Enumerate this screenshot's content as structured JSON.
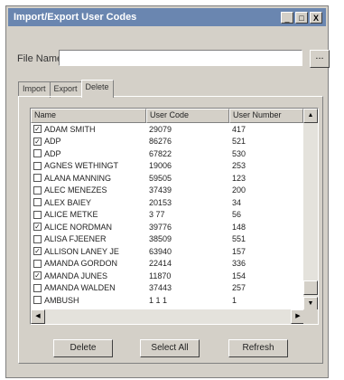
{
  "window": {
    "title": "Import/Export User Codes",
    "minimize": "_",
    "maximize": "□",
    "close": "X"
  },
  "file": {
    "label": "File Name",
    "value": "",
    "browse_label": "..."
  },
  "tabs": [
    {
      "label": "Import"
    },
    {
      "label": "Export"
    },
    {
      "label": "Delete"
    }
  ],
  "table": {
    "headers": [
      "Name",
      "User Code",
      "User Number"
    ],
    "rows": [
      {
        "checked": true,
        "name": "ADAM SMITH",
        "code": "29079",
        "number": "417"
      },
      {
        "checked": true,
        "name": "ADP",
        "code": "86276",
        "number": "521"
      },
      {
        "checked": false,
        "name": "ADP",
        "code": "67822",
        "number": "530"
      },
      {
        "checked": false,
        "name": "AGNES WETHINGT",
        "code": "19006",
        "number": "253"
      },
      {
        "checked": false,
        "name": "ALANA MANNING",
        "code": "59505",
        "number": "123"
      },
      {
        "checked": false,
        "name": "ALEC MENEZES",
        "code": "37439",
        "number": "200"
      },
      {
        "checked": false,
        "name": "ALEX BAIEY",
        "code": "20153",
        "number": "34"
      },
      {
        "checked": false,
        "name": "ALICE METKE",
        "code": "3 77",
        "number": "56"
      },
      {
        "checked": true,
        "name": "ALICE NORDMAN",
        "code": "39776",
        "number": "148"
      },
      {
        "checked": false,
        "name": "ALISA FJEENER",
        "code": "38509",
        "number": "551"
      },
      {
        "checked": true,
        "name": "ALLISON LANEY JE",
        "code": "63940",
        "number": "157"
      },
      {
        "checked": false,
        "name": "AMANDA GORDON",
        "code": "22414",
        "number": "336"
      },
      {
        "checked": true,
        "name": "AMANDA JUNES",
        "code": "11870",
        "number": "154"
      },
      {
        "checked": false,
        "name": "AMANDA WALDEN",
        "code": "37443",
        "number": "257"
      },
      {
        "checked": false,
        "name": "AMBUSH",
        "code": "1 1 1",
        "number": "1"
      }
    ]
  },
  "buttons": {
    "delete": "Delete",
    "select_all": "Select All",
    "refresh": "Refresh"
  },
  "glyphs": {
    "check": "✓",
    "up": "▲",
    "down": "▼",
    "left": "◀",
    "right": "▶"
  }
}
